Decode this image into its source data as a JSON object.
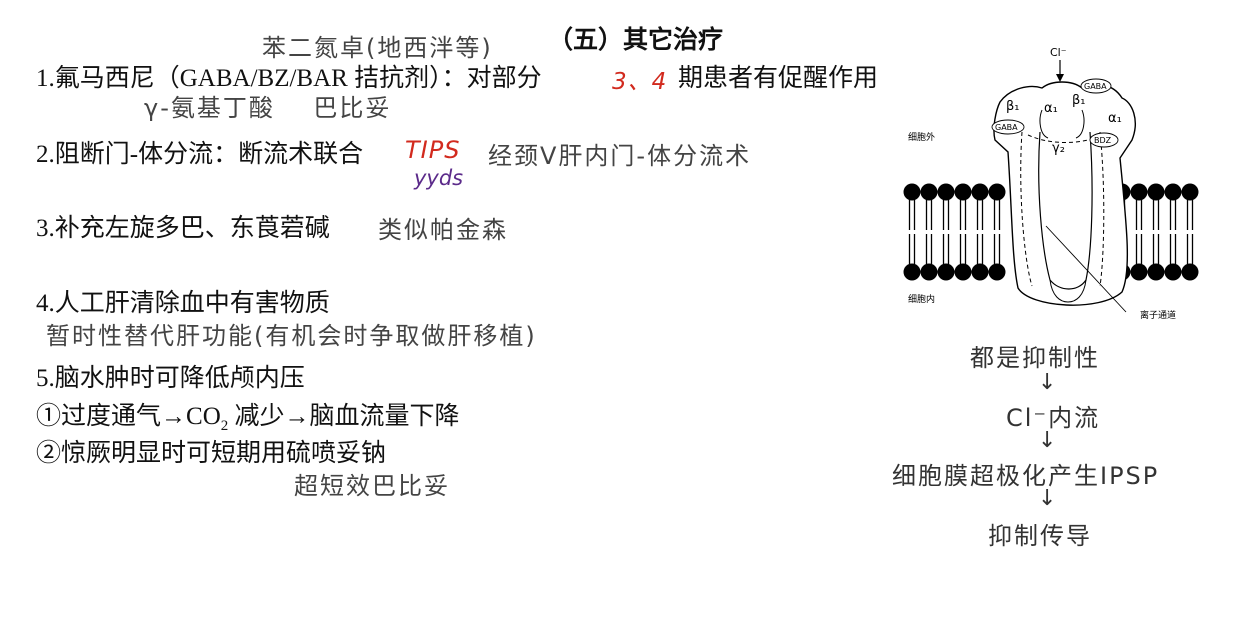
{
  "header": {
    "annotation": "苯二氮卓(地西泮等)",
    "title": "（五）其它治疗"
  },
  "items": [
    {
      "number": "1.",
      "text": "氟马西尼（GABA/BZ/BAR 拮抗剂）：对部分",
      "annotation_red": "3、4",
      "text_after": "期患者有促醒作用",
      "annotation_below": "γ-氨基丁酸    巴比妥"
    },
    {
      "number": "2.",
      "text": "阻断门-体分流：断流术联合",
      "annotation_red": "TIPS",
      "annotation_after": "经颈V肝内门-体分流术",
      "annotation_below": "yyds"
    },
    {
      "number": "3.",
      "text": "补充左旋多巴、东莨菪碱",
      "annotation_after": "类似帕金森"
    },
    {
      "number": "4.",
      "text": "人工肝清除血中有害物质",
      "annotation_below": "暂时性替代肝功能(有机会时争取做肝移植)"
    },
    {
      "number": "5.",
      "text": "脑水肿时可降低颅内压"
    }
  ],
  "sub_items": [
    {
      "marker": "①",
      "text_before": "过度通气→CO",
      "subscript": "2",
      "text_after": " 减少→脑血流量下降"
    },
    {
      "marker": "②",
      "text": "惊厥明显时可短期用硫喷妥钠",
      "annotation_below": "超短效巴比妥"
    }
  ],
  "diagram": {
    "labels": {
      "cl": "Cl⁻",
      "gaba_top": "GABA",
      "gaba_left": "GABA",
      "bdz": "BDZ",
      "beta1_left": "β₁",
      "alpha1_left": "α₁",
      "beta1_right": "β₁",
      "alpha1_right": "α₁",
      "gamma2": "γ₂",
      "outside": "细胞外",
      "inside": "细胞内",
      "channel": "离子通道"
    }
  },
  "flow": {
    "steps": [
      "都是抑制性",
      "Cl⁻内流",
      "细胞膜超极化产生IPSP",
      "抑制传导"
    ],
    "arrow": "↓"
  }
}
